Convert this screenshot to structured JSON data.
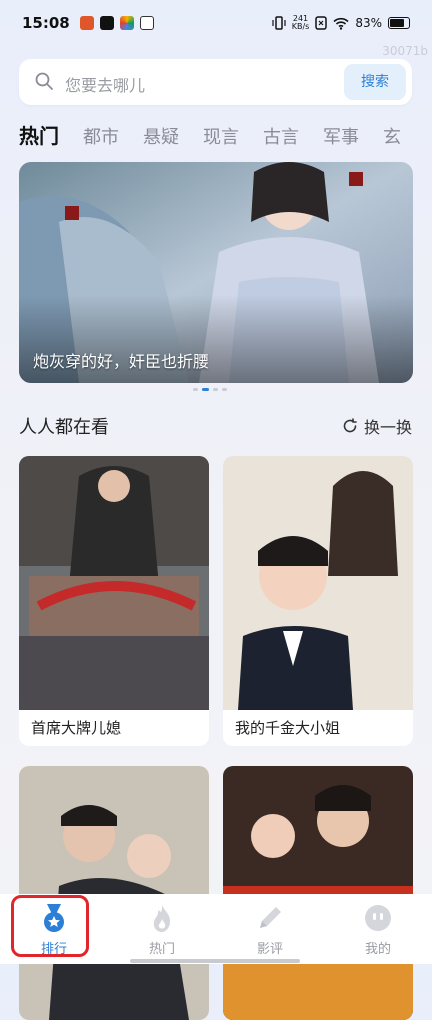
{
  "status": {
    "time": "15:08",
    "net_speed_top": "241",
    "net_speed_bottom": "KB/s",
    "battery": "83%"
  },
  "watermark": "30071b",
  "search": {
    "placeholder": "您要去哪儿",
    "button_label": "搜索"
  },
  "categories": [
    "热门",
    "都市",
    "悬疑",
    "现言",
    "古言",
    "军事",
    "玄"
  ],
  "banner": {
    "title": "炮灰穿的好，奸臣也折腰",
    "dots": 4,
    "active_dot": 1
  },
  "section": {
    "title": "人人都在看",
    "refresh_label": "换一换"
  },
  "cards": [
    {
      "title": "首席大牌儿媳"
    },
    {
      "title": "我的千金大小姐"
    },
    {
      "title": ""
    },
    {
      "title": ""
    }
  ],
  "nav": [
    {
      "label": "排行",
      "icon": "medal-icon",
      "active": true
    },
    {
      "label": "热门",
      "icon": "flame-icon",
      "active": false
    },
    {
      "label": "影评",
      "icon": "pencil-icon",
      "active": false
    },
    {
      "label": "我的",
      "icon": "smiley-icon",
      "active": false
    }
  ],
  "colors": {
    "accent": "#2c7fd6",
    "highlight": "#e0262b"
  }
}
